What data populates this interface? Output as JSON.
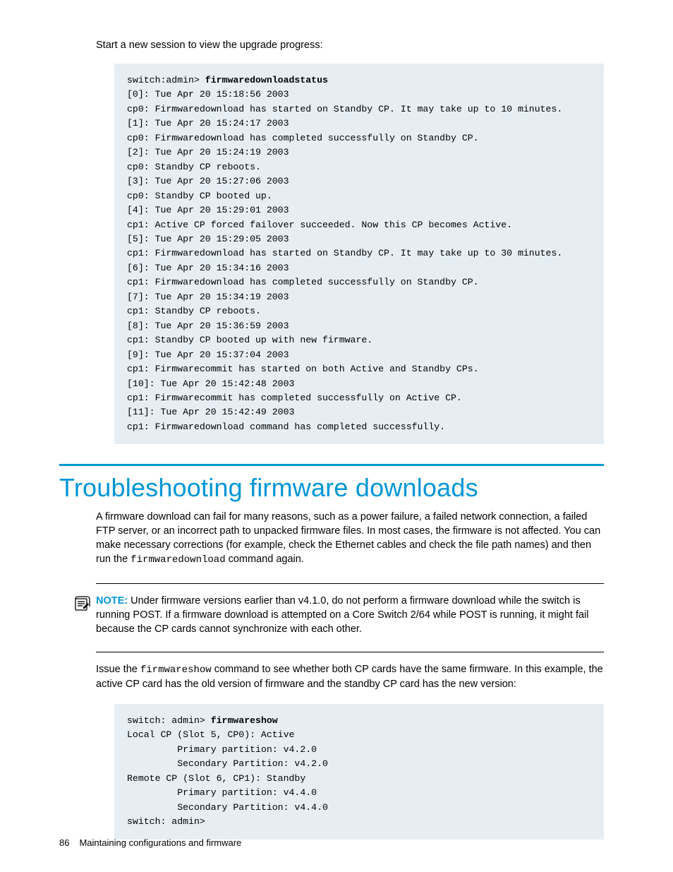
{
  "intro": "Start a new session to view the upgrade progress:",
  "code1": {
    "prompt": "switch:admin> ",
    "cmd": "firmwaredownloadstatus",
    "body": "[0]: Tue Apr 20 15:18:56 2003\ncp0: Firmwaredownload has started on Standby CP. It may take up to 10 minutes.\n[1]: Tue Apr 20 15:24:17 2003\ncp0: Firmwaredownload has completed successfully on Standby CP.\n[2]: Tue Apr 20 15:24:19 2003\ncp0: Standby CP reboots.\n[3]: Tue Apr 20 15:27:06 2003\ncp0: Standby CP booted up.\n[4]: Tue Apr 20 15:29:01 2003\ncp1: Active CP forced failover succeeded. Now this CP becomes Active.\n[5]: Tue Apr 20 15:29:05 2003\ncp1: Firmwaredownload has started on Standby CP. It may take up to 30 minutes.\n[6]: Tue Apr 20 15:34:16 2003\ncp1: Firmwaredownload has completed successfully on Standby CP.\n[7]: Tue Apr 20 15:34:19 2003\ncp1: Standby CP reboots.\n[8]: Tue Apr 20 15:36:59 2003\ncp1: Standby CP booted up with new firmware.\n[9]: Tue Apr 20 15:37:04 2003\ncp1: Firmwarecommit has started on both Active and Standby CPs.\n[10]: Tue Apr 20 15:42:48 2003\ncp1: Firmwarecommit has completed successfully on Active CP.\n[11]: Tue Apr 20 15:42:49 2003\ncp1: Firmwaredownload command has completed successfully."
  },
  "section_title": "Troubleshooting firmware downloads",
  "para1a": "A firmware download can fail for many reasons, such as a power failure, a failed network connection, a failed FTP server, or an incorrect path to unpacked firmware files. In most cases, the firmware is not affected. You can make necessary corrections (for example, check the Ethernet cables and check the file path names) and then run the ",
  "para1_cmd": "firmwaredownload",
  "para1b": " command again.",
  "note_label": "NOTE:",
  "note_body": "   Under firmware versions earlier than v4.1.0, do not perform a firmware download while the switch is running POST. If a firmware download is attempted on a Core Switch 2/64 while POST is running, it might fail because the CP cards cannot synchronize with each other.",
  "para2a": "Issue the ",
  "para2_cmd": "firmwareshow",
  "para2b": " command to see whether both CP cards have the same firmware. In this example, the active CP card has the old version of firmware and the standby CP card has the new version:",
  "code2": {
    "prompt": "switch: admin> ",
    "cmd": "firmwareshow",
    "body": "Local CP (Slot 5, CP0): Active\n         Primary partition: v4.2.0\n         Secondary Partition: v4.2.0\nRemote CP (Slot 6, CP1): Standby\n         Primary partition: v4.4.0\n         Secondary Partition: v4.4.0\nswitch: admin>"
  },
  "footer": {
    "page": "86",
    "chapter": "Maintaining configurations and firmware"
  }
}
